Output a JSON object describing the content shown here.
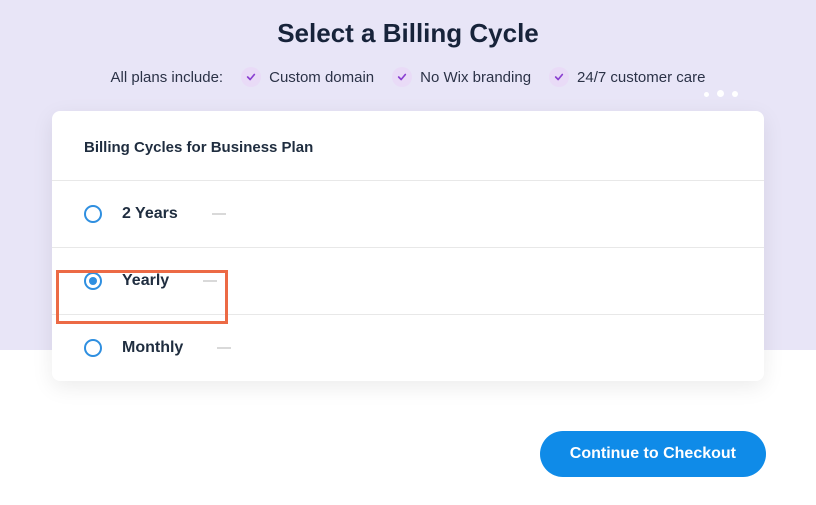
{
  "header": {
    "title": "Select a Billing Cycle",
    "perks_label": "All plans include:",
    "perks": [
      {
        "label": "Custom domain"
      },
      {
        "label": "No Wix branding"
      },
      {
        "label": "24/7 customer care"
      }
    ]
  },
  "card": {
    "title": "Billing Cycles for Business Plan",
    "options": [
      {
        "label": "2 Years",
        "selected": false
      },
      {
        "label": "Yearly",
        "selected": true
      },
      {
        "label": "Monthly",
        "selected": false
      }
    ]
  },
  "actions": {
    "checkout_label": "Continue to Checkout"
  }
}
